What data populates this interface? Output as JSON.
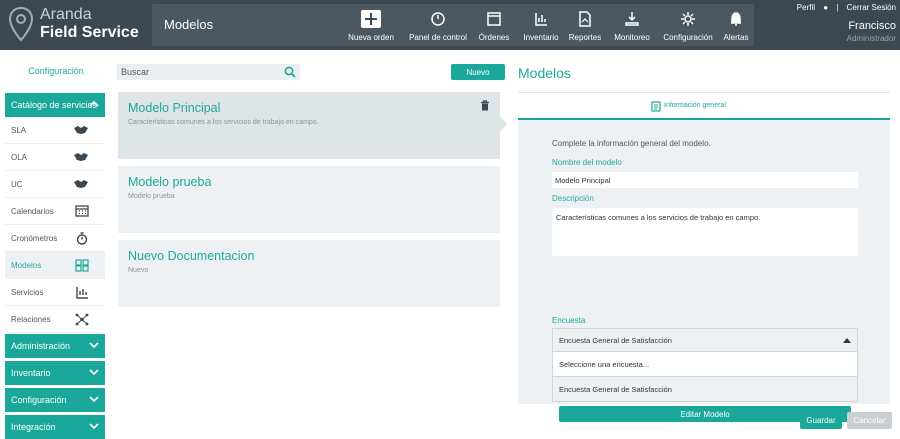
{
  "brand": {
    "line1": "Aranda",
    "line2": "Field Service"
  },
  "header": {
    "section_title": "Modelos",
    "nav": [
      {
        "label": "Nueva orden",
        "icon": "plus-icon"
      },
      {
        "label": "Panel de control",
        "icon": "dashboard-icon"
      },
      {
        "label": "Órdenes",
        "icon": "orders-icon"
      },
      {
        "label": "Inventario",
        "icon": "inventory-icon"
      },
      {
        "label": "Reportes",
        "icon": "reports-icon"
      },
      {
        "label": "Monitoreo",
        "icon": "monitoring-icon"
      },
      {
        "label": "Configuración",
        "icon": "gear-icon"
      },
      {
        "label": "Alertas",
        "icon": "bell-icon"
      }
    ],
    "user": {
      "profile_link": "Perfil",
      "logout_link": "Cerrar Sesión",
      "name": "Francisco",
      "role": "Administrador"
    }
  },
  "sidebar": {
    "title": "Configuración",
    "expanded_group": "Catálogo de servicios",
    "items": [
      {
        "label": "SLA",
        "icon": "handshake-icon"
      },
      {
        "label": "OLA",
        "icon": "handshake-icon"
      },
      {
        "label": "UC",
        "icon": "handshake-icon"
      },
      {
        "label": "Calendarios",
        "icon": "calendar-icon"
      },
      {
        "label": "Cronómetros",
        "icon": "stopwatch-icon"
      },
      {
        "label": "Modelos",
        "icon": "models-icon"
      },
      {
        "label": "Servicios",
        "icon": "services-icon"
      },
      {
        "label": "Relaciones",
        "icon": "relations-icon"
      }
    ],
    "active_item": "Modelos",
    "collapsed_groups": [
      "Administración",
      "Inventario",
      "Configuración",
      "Integración"
    ]
  },
  "list": {
    "search_placeholder": "Buscar",
    "new_button": "Nuevo",
    "cards": [
      {
        "title": "Modelo Principal",
        "description": "Características comunes a los servicios de trabajo en campo."
      },
      {
        "title": "Modelo prueba",
        "description": "Modelo prueba"
      },
      {
        "title": "Nuevo Documentacion",
        "description": "Nuevo"
      }
    ]
  },
  "detail": {
    "heading": "Modelos",
    "tab_label": "Información general",
    "intro": "Complete la información general del modelo.",
    "name_label": "Nombre del modelo",
    "name_value": "Modelo Principal",
    "description_label": "Descripción",
    "description_value": "Características comunes a los servicios de trabajo en campo.",
    "survey_label": "Encuesta",
    "survey_selected": "Encuesta General de Satisfacción",
    "survey_options": [
      "Seleccione una encuesta...",
      "Encuesta General de Satisfacción"
    ],
    "edit_button": "Editar Modelo"
  },
  "footer": {
    "save_button": "Guardar",
    "cancel_button": "Cancelar"
  },
  "colors": {
    "accent": "#19a899",
    "topbar": "#3b4852"
  }
}
